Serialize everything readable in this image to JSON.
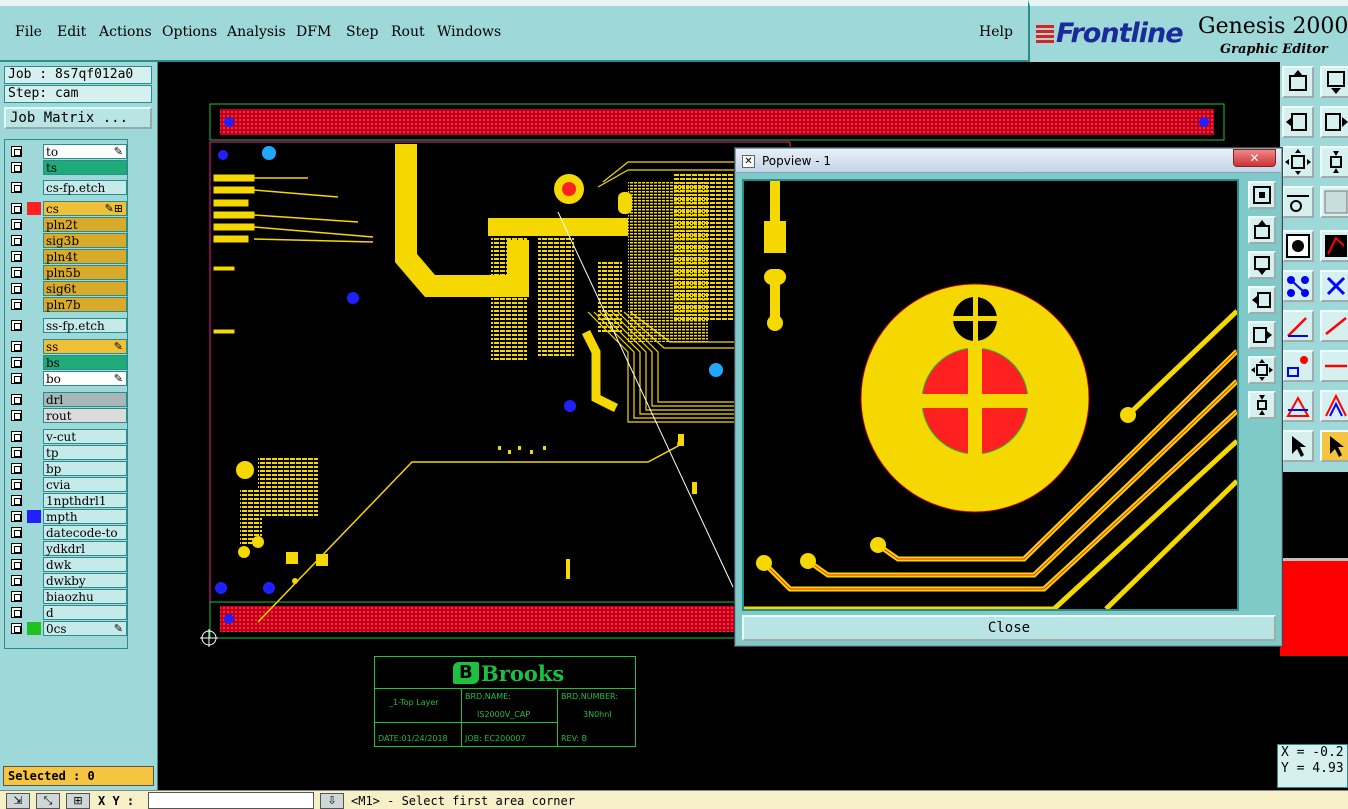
{
  "menu": {
    "items": [
      "File",
      "Edit",
      "Actions",
      "Options",
      "Analysis",
      "DFM",
      "Step",
      "Rout",
      "Windows"
    ],
    "help": "Help"
  },
  "brand": {
    "logo": "Frontline",
    "product": "Genesis 2000",
    "subtitle": "Graphic Editor"
  },
  "job": {
    "job_line": "Job : 8s7qf012a0",
    "step_line": "Step: cam",
    "matrix_button": "Job Matrix ..."
  },
  "layers": [
    {
      "name": "to",
      "color": "#ffffff",
      "swatch": "",
      "mark": "✎"
    },
    {
      "name": "ts",
      "color": "#1faa7a",
      "swatch": "",
      "mark": ""
    },
    {
      "name": "cs-fp.etch",
      "color": "#c6eaea",
      "swatch": "",
      "mark": ""
    },
    {
      "name": "cs",
      "color": "#f0c038",
      "swatch": "#ff2020",
      "mark": "✎⊞"
    },
    {
      "name": "pln2t",
      "color": "#d9a92a",
      "swatch": "",
      "mark": ""
    },
    {
      "name": "sig3b",
      "color": "#d9a92a",
      "swatch": "",
      "mark": ""
    },
    {
      "name": "pln4t",
      "color": "#d9a92a",
      "swatch": "",
      "mark": ""
    },
    {
      "name": "pln5b",
      "color": "#d9a92a",
      "swatch": "",
      "mark": ""
    },
    {
      "name": "sig6t",
      "color": "#d9a92a",
      "swatch": "",
      "mark": ""
    },
    {
      "name": "pln7b",
      "color": "#d9a92a",
      "swatch": "",
      "mark": ""
    },
    {
      "name": "ss-fp.etch",
      "color": "#c6eaea",
      "swatch": "",
      "mark": ""
    },
    {
      "name": "ss",
      "color": "#f0c038",
      "swatch": "",
      "mark": "✎"
    },
    {
      "name": "bs",
      "color": "#1faa7a",
      "swatch": "",
      "mark": ""
    },
    {
      "name": "bo",
      "color": "#ffffff",
      "swatch": "",
      "mark": "✎"
    },
    {
      "name": "drl",
      "color": "#a8b8b8",
      "swatch": "",
      "mark": ""
    },
    {
      "name": "rout",
      "color": "#dcdcdc",
      "swatch": "",
      "mark": ""
    },
    {
      "name": "v-cut",
      "color": "#c6eaea",
      "swatch": "",
      "mark": ""
    },
    {
      "name": "tp",
      "color": "#c6eaea",
      "swatch": "",
      "mark": ""
    },
    {
      "name": "bp",
      "color": "#c6eaea",
      "swatch": "",
      "mark": ""
    },
    {
      "name": "cvia",
      "color": "#c6eaea",
      "swatch": "",
      "mark": ""
    },
    {
      "name": "1npthdrl1",
      "color": "#c6eaea",
      "swatch": "",
      "mark": ""
    },
    {
      "name": "mpth",
      "color": "#c6eaea",
      "swatch": "#2020ff",
      "mark": ""
    },
    {
      "name": "datecode-to",
      "color": "#c6eaea",
      "swatch": "",
      "mark": ""
    },
    {
      "name": "ydkdrl",
      "color": "#c6eaea",
      "swatch": "",
      "mark": ""
    },
    {
      "name": "dwk",
      "color": "#c6eaea",
      "swatch": "",
      "mark": ""
    },
    {
      "name": "dwkby",
      "color": "#c6eaea",
      "swatch": "",
      "mark": ""
    },
    {
      "name": "biaozhu",
      "color": "#c6eaea",
      "swatch": "",
      "mark": ""
    },
    {
      "name": "d",
      "color": "#c6eaea",
      "swatch": "",
      "mark": ""
    },
    {
      "name": "0cs",
      "color": "#c6eaea",
      "swatch": "#20c020",
      "mark": "✎"
    }
  ],
  "selected": "Selected : 0",
  "status": {
    "xy_label": "X Y :",
    "prompt": "<M1> - Select first area corner"
  },
  "coords": {
    "x": "X = -0.2",
    "y": "Y = 4.93"
  },
  "titleblock": {
    "brand": "Brooks",
    "layer": "_1-Top Layer",
    "brd_name_label": "BRD.NAME:",
    "brd_name_value": "IS2000V_CAP",
    "brd_number_label": "BRD.NUMBER:",
    "brd_number_value": "3N0hnI",
    "date": "DATE:01/24/2018",
    "job": "JOB: EC200007",
    "rev": "REV: B"
  },
  "popview": {
    "title": "Popview - 1",
    "close_x": "✕",
    "close_button": "Close"
  },
  "colors": {
    "panel": "#9ed8d8",
    "copper": "#f5d800",
    "drill": "#ff2020",
    "via": "#2020ff",
    "outline": "#1fbf3f",
    "border_pad": "#b0001a"
  }
}
